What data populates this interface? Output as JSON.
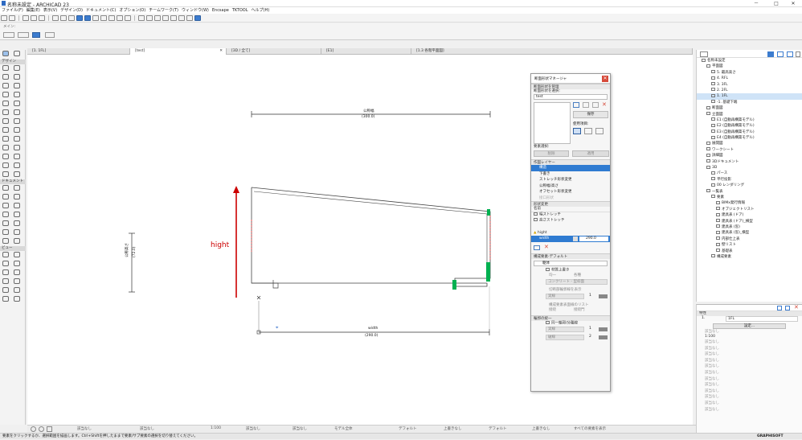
{
  "titlebar": {
    "title": "名称未設定 - ARCHICAD 23",
    "min": "－",
    "max": "□",
    "close": "✕"
  },
  "menu": [
    "ファイル(F)",
    "編集(E)",
    "表示(V)",
    "デザイン(D)",
    "ドキュメント(C)",
    "オプション(O)",
    "チームワーク(T)",
    "ウィンドウ(W)",
    "Encsape",
    "TKTOOL",
    "ヘルプ(H)"
  ],
  "toolbar2_label": "メイン:",
  "left_toolbox": {
    "headers": [
      "デザイン",
      "ドキュメント",
      "ビュー"
    ]
  },
  "tabs": [
    "[1. 1FL]",
    "[test]",
    "[3D / 全て]",
    "[E1]",
    "[1.3 各階平面図]"
  ],
  "drawing": {
    "top_dim_label": "公称幅",
    "top_dim_value": "(300.0)",
    "left_dim_label": "公称高さ",
    "left_dim_value": "(72.0)",
    "bottom_dim_label": "width",
    "bottom_dim_value": "(290.0)",
    "hight_label": "hight",
    "accent": "#cc0000",
    "green": "#00b050"
  },
  "palette": {
    "title": "断面形状マネージャ",
    "sec_manage": "断面形状を管理",
    "choose_label": "断面形状を選択:",
    "profile_value": "test",
    "save_button": "保存",
    "usage_label": "使用項目:",
    "element_select": "要素選択:",
    "delete_btn": "削除",
    "pick_btn": "適用",
    "sec_layers": "作図レイヤー",
    "layers": [
      "構造",
      "下書き",
      "ストレッチ形状変更",
      "公称幅/高さ",
      "オフセット形状変更",
      "接口形状"
    ],
    "sec_modify": "形状変更",
    "name_header": "名前",
    "stretch_h": "幅ストレッチ",
    "stretch_v": "高さストレッチ",
    "param_hight": "hight",
    "param_width": "width",
    "param_width_value": "290.0",
    "sec_default": "構成要素-デフォルト",
    "material": "躯体",
    "override": "材質上書き",
    "uniform": "均一",
    "each": "各種",
    "surface_value": "コンクリート - 型枠面",
    "cut_line": "切断部輪郭線を表示",
    "linetype": "実線",
    "pen1": "1",
    "comp_header": "構成要素表面線のリスト",
    "comp_label": "接続",
    "comp_pen": "接続門",
    "sec_outline": "輪郭の統一",
    "same_contour": "同一輪郭/分離線",
    "line1": "実線",
    "line2": "破線",
    "pen_a": "1",
    "pen_b": "2"
  },
  "navigator": {
    "items": [
      {
        "text": "名称未設定",
        "indent": 1
      },
      {
        "text": "平面図",
        "indent": 2
      },
      {
        "text": "5. 最高高さ",
        "indent": 3
      },
      {
        "text": "4. RFL",
        "indent": 3
      },
      {
        "text": "3. 3FL",
        "indent": 3
      },
      {
        "text": "2. 2FL",
        "indent": 3
      },
      {
        "text": "1. 1FL",
        "indent": 3,
        "sel": true
      },
      {
        "text": "-1. 基礎下端",
        "indent": 3
      },
      {
        "text": "断面図",
        "indent": 2
      },
      {
        "text": "立面図",
        "indent": 2
      },
      {
        "text": "E1 (自動再構築モデル)",
        "indent": 3
      },
      {
        "text": "E2 (自動再構築モデル)",
        "indent": 3
      },
      {
        "text": "E3 (自動再構築モデル)",
        "indent": 3
      },
      {
        "text": "E4 (自動再構築モデル)",
        "indent": 3
      },
      {
        "text": "展開図",
        "indent": 2
      },
      {
        "text": "ワークシート",
        "indent": 2
      },
      {
        "text": "詳細図",
        "indent": 2
      },
      {
        "text": "3Dドキュメント",
        "indent": 2
      },
      {
        "text": "3D",
        "indent": 2
      },
      {
        "text": "パース",
        "indent": 3
      },
      {
        "text": "平行投影",
        "indent": 3
      },
      {
        "text": "00 レンダリング",
        "indent": 3
      },
      {
        "text": "一覧表",
        "indent": 2
      },
      {
        "text": "要素",
        "indent": 3
      },
      {
        "text": "BIMx発行情報",
        "indent": 4
      },
      {
        "text": "オブジェクトリスト",
        "indent": 4
      },
      {
        "text": "建具表 (ドア)",
        "indent": 4
      },
      {
        "text": "建具表 (ドア)_横型",
        "indent": 4
      },
      {
        "text": "建具表 (窓)",
        "indent": 4
      },
      {
        "text": "建具表 (窓)_横型",
        "indent": 4
      },
      {
        "text": "内部仕上表",
        "indent": 4
      },
      {
        "text": "壁リスト",
        "indent": 4
      },
      {
        "text": "基礎表",
        "indent": 4
      },
      {
        "text": "構成要素",
        "indent": 3
      }
    ]
  },
  "info": {
    "header": "特性",
    "floor_num": "1.",
    "floor_name": "1FL",
    "settings_btn": "設定...",
    "scale": "1:100",
    "rows": [
      "該当なし",
      "該当なし",
      "該当なし",
      "該当なし",
      "該当なし",
      "該当なし",
      "該当なし",
      "該当なし",
      "該当なし",
      "該当なし",
      "該当なし",
      "該当なし",
      "該当なし"
    ]
  },
  "status": {
    "scale": "1:100",
    "items": [
      "該当なし",
      "該当なし",
      "該当なし",
      "該当なし",
      "モデル全体",
      "デフォルト",
      "上書きなし",
      "デフォルト",
      "上書きなし",
      "すべての要素を表示"
    ]
  },
  "bottom": {
    "msg": "要素をクリックするか、選択範囲を描画します。Ctrl+Shiftを押したままで要素/サブ要素の選択を切り替えてください。",
    "brand": "GRAPHISOFT"
  }
}
